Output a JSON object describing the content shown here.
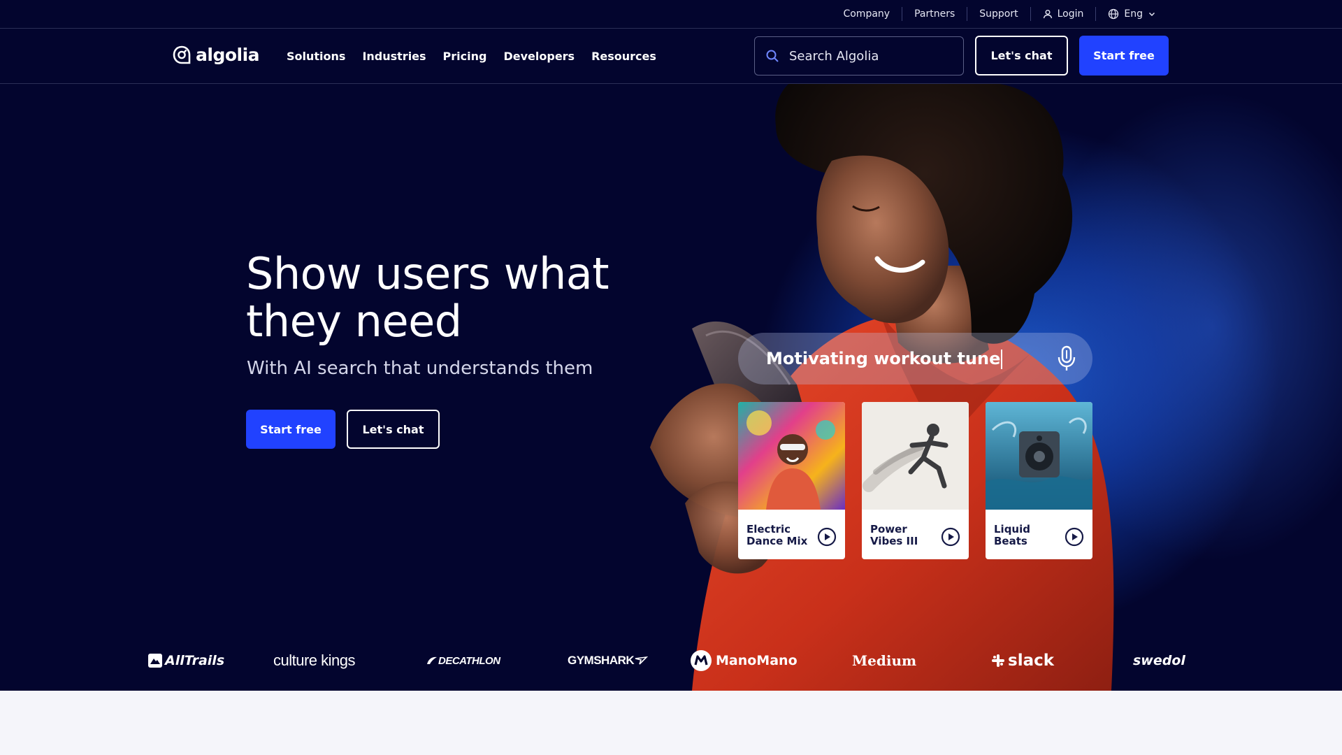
{
  "utility": {
    "company": "Company",
    "partners": "Partners",
    "support": "Support",
    "login": "Login",
    "language": "Eng"
  },
  "nav": {
    "logo_text": "algolia",
    "items": [
      "Solutions",
      "Industries",
      "Pricing",
      "Developers",
      "Resources"
    ],
    "search_placeholder": "Search Algolia",
    "chat_label": "Let's chat",
    "start_label": "Start free"
  },
  "hero": {
    "title": "Show users what they need",
    "subtitle": "With AI search that understands them",
    "start_label": "Start free",
    "chat_label": "Let's chat",
    "voice_query": "Motivating workout tune",
    "cards": [
      {
        "title": "Electric Dance Mix"
      },
      {
        "title": "Power Vibes III"
      },
      {
        "title": "Liquid Beats"
      }
    ]
  },
  "logos": [
    "AllTrails",
    "culture kings",
    "DECATHLON",
    "GYMSHARK",
    "ManoMano",
    "Medium",
    "slack",
    "swedol"
  ],
  "colors": {
    "navy": "#03052e",
    "brand_blue": "#2142ff",
    "person_red": "#d8351f",
    "card_text": "#151946"
  },
  "icons": {
    "search": "search-icon",
    "mic": "microphone-icon",
    "play": "play-circle-icon",
    "user": "user-icon",
    "globe": "globe-icon",
    "chevron": "chevron-down-icon"
  }
}
